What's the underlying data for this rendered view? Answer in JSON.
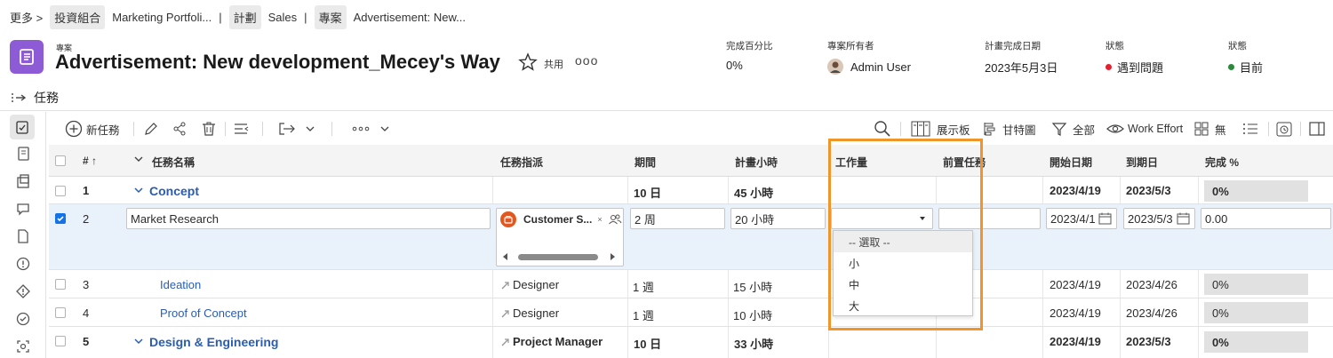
{
  "breadcrumb": {
    "more": "更多 >",
    "items": [
      {
        "label": "投資組合",
        "chip": true
      },
      {
        "label": "Marketing Portfoli...",
        "chip": false
      },
      {
        "label": "計劃",
        "chip": true
      },
      {
        "label": "Sales",
        "chip": false
      },
      {
        "label": "專案",
        "chip": true
      },
      {
        "label": "Advertisement: New...",
        "chip": false
      }
    ]
  },
  "header": {
    "object_type": "專案",
    "title": "Advertisement: New development_Mecey's Way",
    "share_label": "共用",
    "more_label": "ooo",
    "fields": [
      {
        "label": "完成百分比",
        "value": "0%"
      },
      {
        "label": "專案所有者",
        "value": "Admin User"
      },
      {
        "label": "計畫完成日期",
        "value": "2023年5月3日"
      },
      {
        "label": "狀態",
        "value": "遇到問題",
        "color": "#e3202f"
      },
      {
        "label": "狀態",
        "value": "目前",
        "color": "#2a8a3a"
      }
    ]
  },
  "section": {
    "title": "任務"
  },
  "toolbar": {
    "new_task": "新任務",
    "board": "展示板",
    "gantt": "甘特圖",
    "filter": "全部",
    "work_effort": "Work Effort",
    "grouping": "無"
  },
  "columns": {
    "num": "# ↑",
    "name": "任務名稱",
    "assign": "任務指派",
    "duration": "期間",
    "hours": "計畫小時",
    "effort": "工作量",
    "pred": "前置任務",
    "start": "開始日期",
    "due": "到期日",
    "complete": "完成 %"
  },
  "rows": [
    {
      "num": "1",
      "name": "Concept",
      "assign": "",
      "duration": "10 日",
      "hours": "45 小時",
      "start": "2023/4/19",
      "due": "2023/5/3",
      "complete": "0%"
    },
    {
      "num": "2",
      "name": "Market Research",
      "assign": "Customer S...",
      "duration": "2 周",
      "hours": "20 小時",
      "start": "2023/4/1",
      "due": "2023/5/3",
      "complete": "0.00"
    },
    {
      "num": "3",
      "name": "Ideation",
      "assign": "Designer",
      "duration": "1 週",
      "hours": "15 小時",
      "start": "2023/4/19",
      "due": "2023/4/26",
      "complete": "0%"
    },
    {
      "num": "4",
      "name": "Proof of Concept",
      "assign": "Designer",
      "duration": "1 週",
      "hours": "10 小時",
      "start": "2023/4/19",
      "due": "2023/4/26",
      "complete": "0%"
    },
    {
      "num": "5",
      "name": "Design & Engineering",
      "assign": "Project Manager",
      "duration": "10 日",
      "hours": "33 小時",
      "start": "2023/4/19",
      "due": "2023/5/3",
      "complete": "0%"
    }
  ],
  "effort_dropdown": {
    "options": [
      "-- 選取 --",
      "小",
      "中",
      "大"
    ]
  },
  "colors": {
    "accent": "#1473e6",
    "highlight": "#f0952a",
    "app_icon": "#8e5bd6"
  }
}
